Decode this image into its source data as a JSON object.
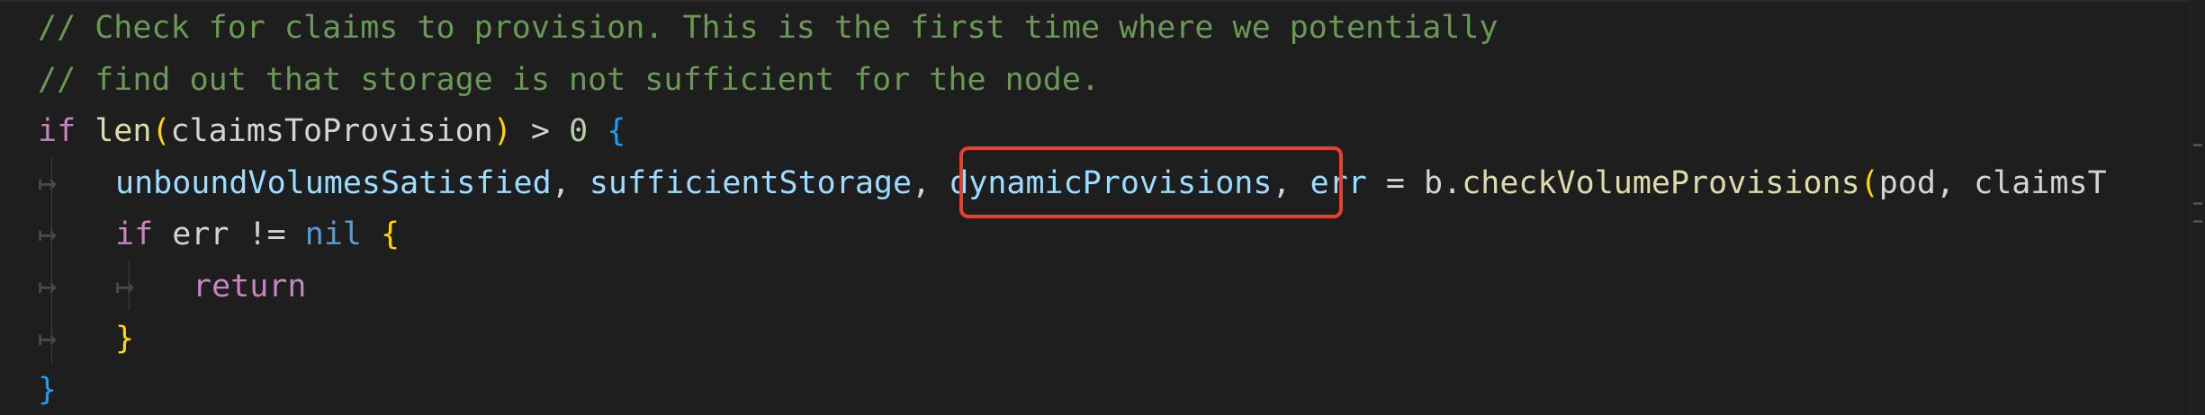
{
  "editor": {
    "lines": [
      {
        "segments": [
          {
            "cls": "t-comment",
            "text": "// Check for claims to provision. This is the first time where we potentially"
          }
        ]
      },
      {
        "segments": [
          {
            "cls": "t-comment",
            "text": "// find out that storage is not sufficient for the node."
          }
        ]
      },
      {
        "segments": [
          {
            "cls": "t-keyword",
            "text": "if"
          },
          {
            "cls": "t-plain",
            "text": " "
          },
          {
            "cls": "t-func",
            "text": "len"
          },
          {
            "cls": "t-paren",
            "text": "("
          },
          {
            "cls": "t-plain",
            "text": "claimsToProvision"
          },
          {
            "cls": "t-paren",
            "text": ")"
          },
          {
            "cls": "t-op",
            "text": " > "
          },
          {
            "cls": "t-num",
            "text": "0"
          },
          {
            "cls": "t-plain",
            "text": " "
          },
          {
            "cls": "t-brace-blue",
            "text": "{"
          }
        ]
      },
      {
        "indent": 1,
        "segments": [
          {
            "cls": "t-var",
            "text": "unboundVolumesSatisfied"
          },
          {
            "cls": "t-plain",
            "text": ", "
          },
          {
            "cls": "t-var",
            "text": "sufficientStorage"
          },
          {
            "cls": "t-plain",
            "text": ", "
          },
          {
            "cls": "t-var",
            "text": "dynamicProvisions"
          },
          {
            "cls": "t-plain",
            "text": ", "
          },
          {
            "cls": "t-var",
            "text": "err"
          },
          {
            "cls": "t-op",
            "text": " = "
          },
          {
            "cls": "t-plain",
            "text": "b."
          },
          {
            "cls": "t-func",
            "text": "checkVolumeProvisions"
          },
          {
            "cls": "t-paren",
            "text": "("
          },
          {
            "cls": "t-plain",
            "text": "pod, claimsT"
          }
        ]
      },
      {
        "indent": 1,
        "segments": [
          {
            "cls": "t-keyword",
            "text": "if"
          },
          {
            "cls": "t-plain",
            "text": " err "
          },
          {
            "cls": "t-op",
            "text": "!="
          },
          {
            "cls": "t-plain",
            "text": " "
          },
          {
            "cls": "t-nil",
            "text": "nil"
          },
          {
            "cls": "t-plain",
            "text": " "
          },
          {
            "cls": "t-brace-yellow",
            "text": "{"
          }
        ]
      },
      {
        "indent": 2,
        "segments": [
          {
            "cls": "t-keyword",
            "text": "return"
          }
        ]
      },
      {
        "indent": 1,
        "segments": [
          {
            "cls": "t-brace-yellow",
            "text": "}"
          }
        ]
      },
      {
        "segments": [
          {
            "cls": "t-brace-blue",
            "text": "}"
          }
        ]
      }
    ],
    "indent_glyph": "↦",
    "highlighted_token": "dynamicProvisions"
  }
}
